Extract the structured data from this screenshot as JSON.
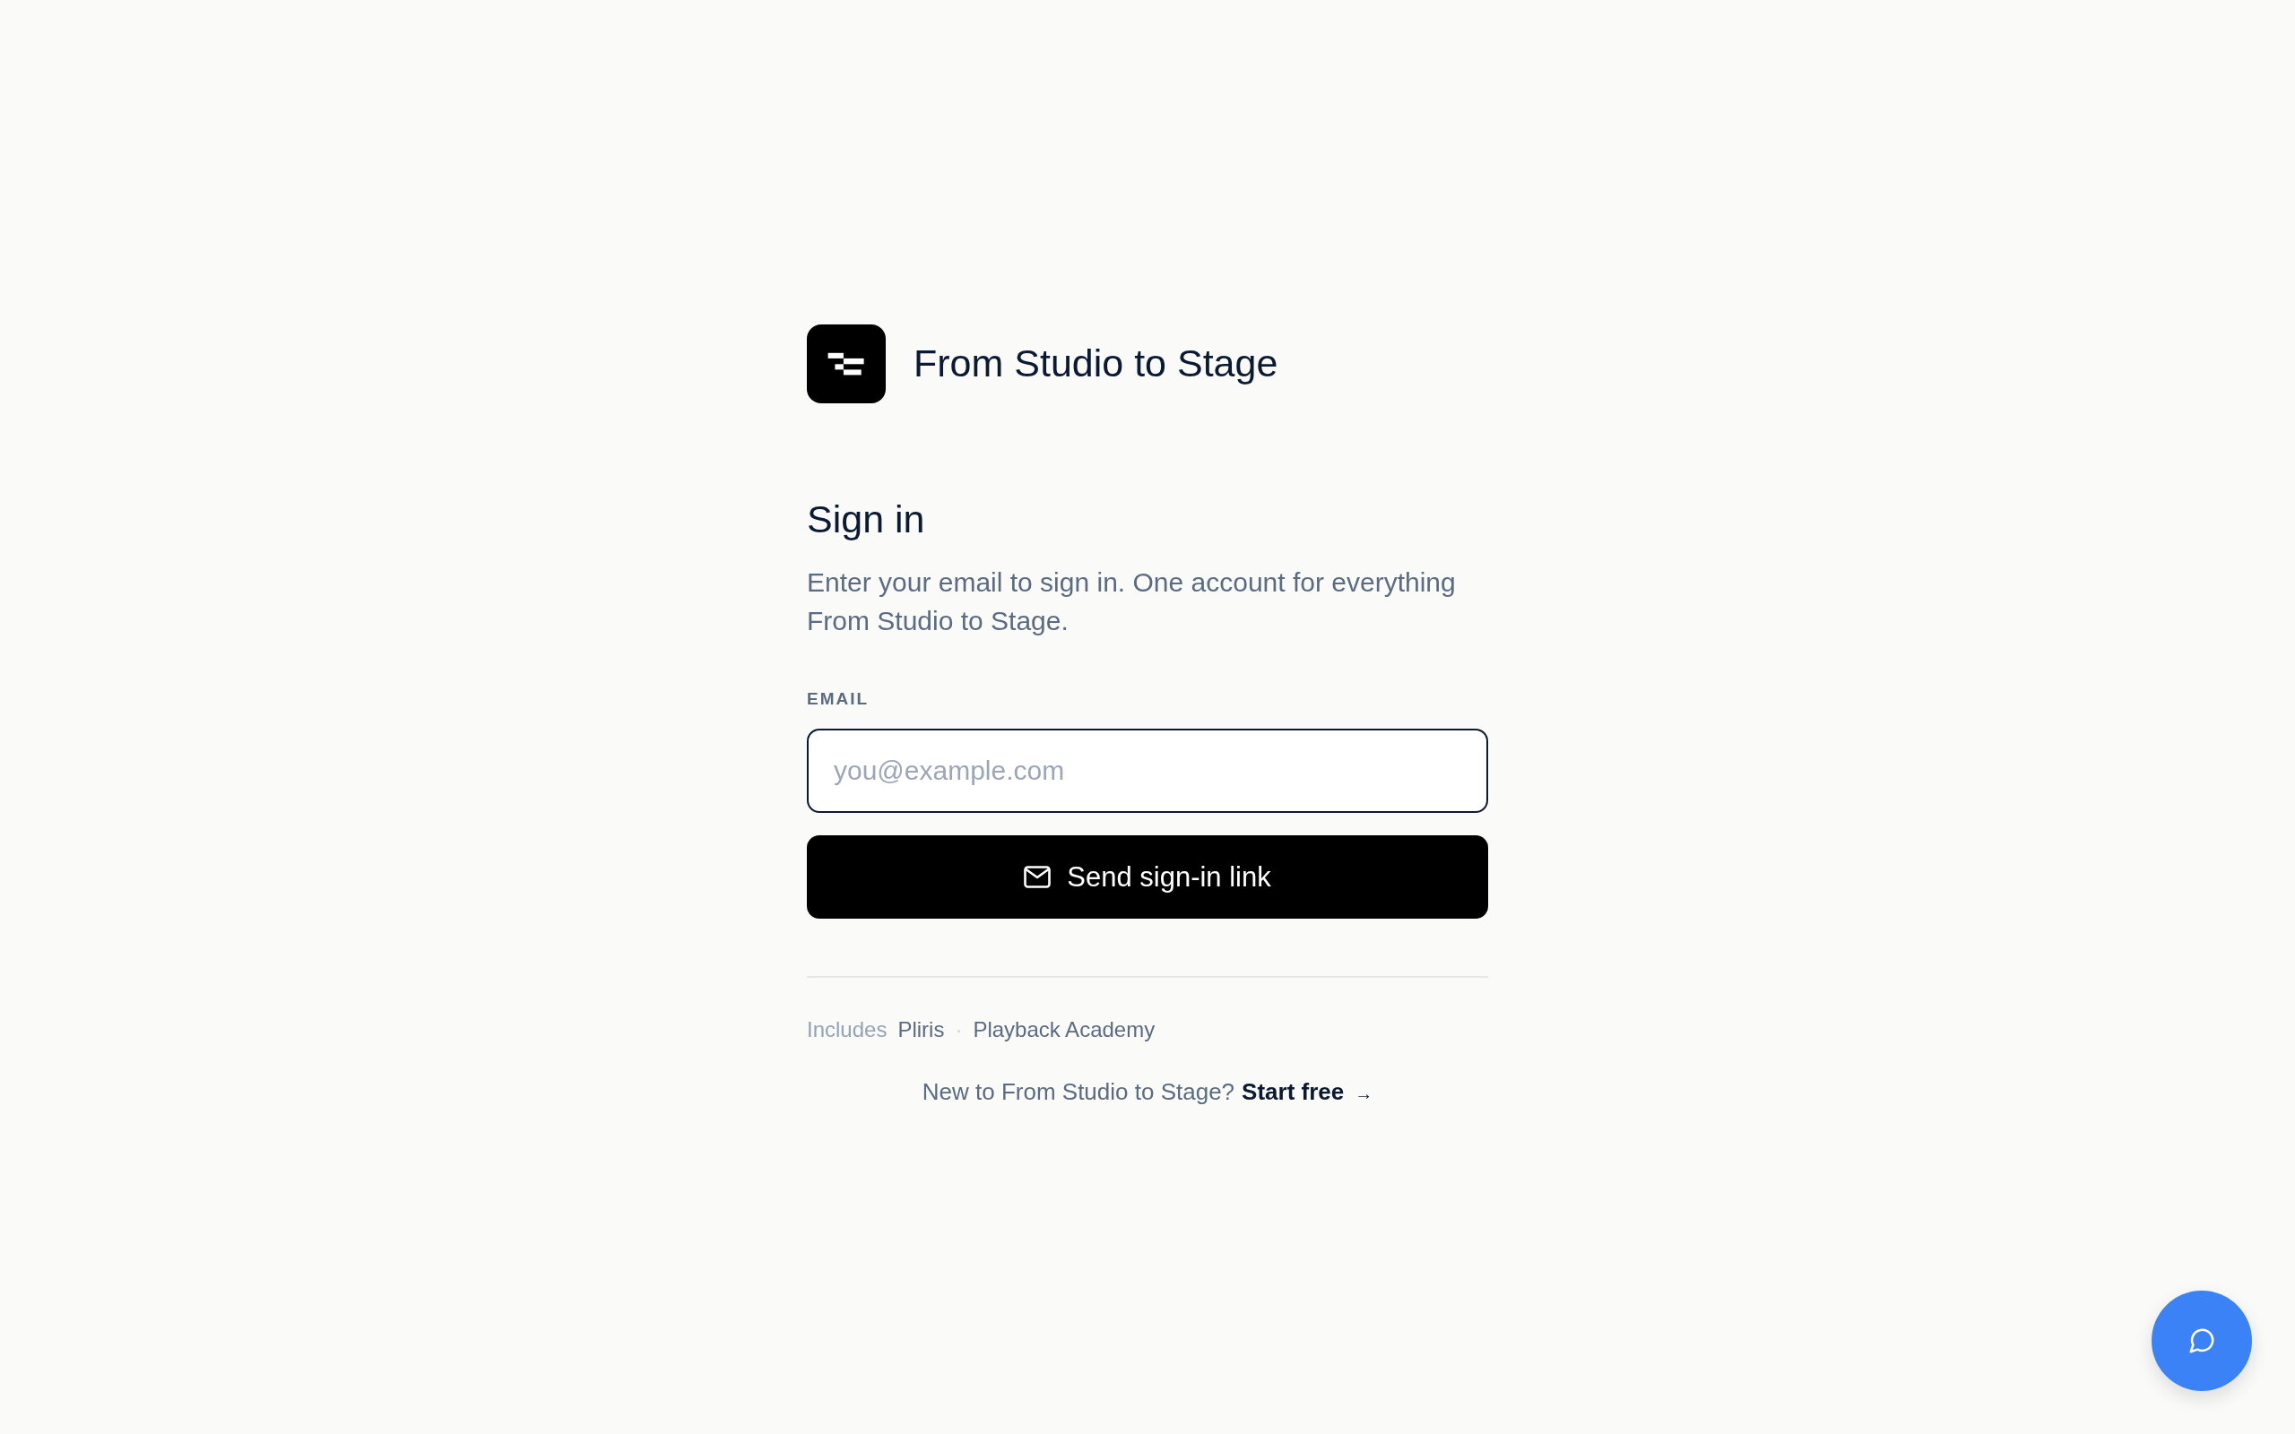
{
  "brand": {
    "name": "From Studio to Stage"
  },
  "heading": "Sign in",
  "description": "Enter your email to sign in. One account for everything From Studio to Stage.",
  "email_field": {
    "label": "EMAIL",
    "placeholder": "you@example.com"
  },
  "submit_button": {
    "label": "Send sign-in link"
  },
  "includes": {
    "label": "Includes",
    "products": [
      "Pliris",
      "Playback Academy"
    ],
    "separator": "·"
  },
  "signup": {
    "prompt": "New to From Studio to Stage?",
    "link": "Start free",
    "arrow": "→"
  }
}
